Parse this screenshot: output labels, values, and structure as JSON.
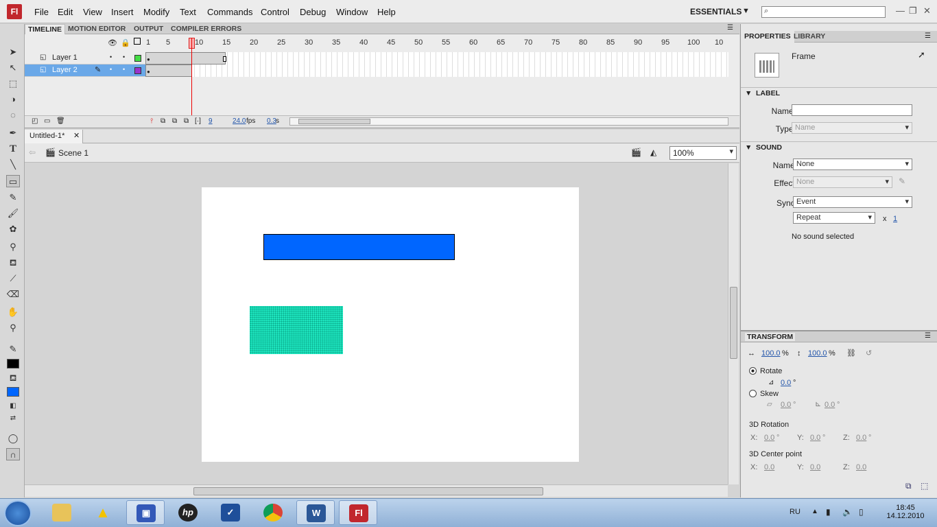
{
  "app": {
    "logo": "Fl"
  },
  "menu": [
    "File",
    "Edit",
    "View",
    "Insert",
    "Modify",
    "Text",
    "Commands",
    "Control",
    "Debug",
    "Window",
    "Help"
  ],
  "workspace": "ESSENTIALS",
  "timeline": {
    "tabs": [
      "TIMELINE",
      "MOTION EDITOR",
      "OUTPUT",
      "COMPILER ERRORS"
    ],
    "ruler": [
      "1",
      "5",
      "10",
      "15",
      "20",
      "25",
      "30",
      "35",
      "40",
      "45",
      "50",
      "55",
      "60",
      "65",
      "70",
      "75",
      "80",
      "85",
      "90",
      "95",
      "100",
      "10"
    ],
    "layers": [
      {
        "name": "Layer 1",
        "color": "#44dd44",
        "selected": false
      },
      {
        "name": "Layer 2",
        "color": "#9933cc",
        "selected": true
      }
    ],
    "current_frame": "9",
    "fps": "24.0",
    "fps_unit": "fps",
    "time": "0.3",
    "time_unit": "s"
  },
  "document": {
    "tab": "Untitled-1*",
    "scene": "Scene 1",
    "zoom": "100%"
  },
  "properties": {
    "tabs": [
      "PROPERTIES",
      "LIBRARY"
    ],
    "type": "Frame",
    "label_section": "LABEL",
    "name_label": "Name:",
    "name_value": "",
    "type_label": "Type:",
    "type_value": "Name",
    "sound_section": "SOUND",
    "sound_name_label": "Name:",
    "sound_name_value": "None",
    "effect_label": "Effect:",
    "effect_value": "None",
    "sync_label": "Sync:",
    "sync_value": "Event",
    "repeat_value": "Repeat",
    "repeat_x": "x",
    "repeat_count": "1",
    "no_sound": "No sound selected"
  },
  "transform": {
    "title": "TRANSFORM",
    "width_pct": "100.0",
    "height_pct": "100.0",
    "pct": "%",
    "rotate_label": "Rotate",
    "rotate_value": "0.0",
    "skew_label": "Skew",
    "skew_h": "0.0",
    "skew_v": "0.0",
    "deg": "°",
    "rot3d_label": "3D Rotation",
    "rot3d": {
      "x": "0.0",
      "y": "0.0",
      "z": "0.0"
    },
    "center3d_label": "3D Center point",
    "center3d": {
      "x": "0.0",
      "y": "0.0",
      "z": "0.0"
    },
    "x_label": "X:",
    "y_label": "Y:",
    "z_label": "Z:"
  },
  "taskbar": {
    "lang": "RU",
    "time": "18:45",
    "date": "14.12.2010"
  },
  "colors": {
    "stroke": "#000000",
    "fill": "#0066ff",
    "blue_rect": "#0066ff",
    "teal_rect": "#1ee6c0"
  }
}
